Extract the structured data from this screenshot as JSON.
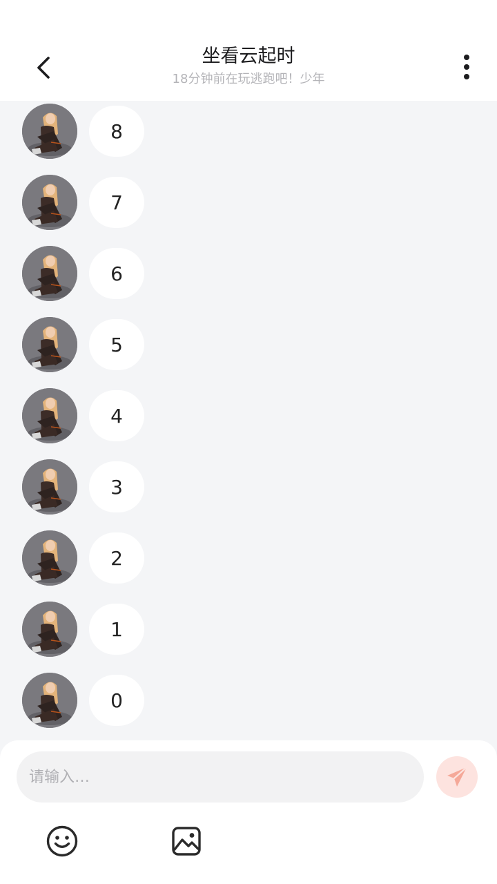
{
  "header": {
    "title": "坐看云起时",
    "subtitle": "18分钟前在玩逃跑吧！少年"
  },
  "messages": [
    {
      "text": "8"
    },
    {
      "text": "7"
    },
    {
      "text": "6"
    },
    {
      "text": "5"
    },
    {
      "text": "4"
    },
    {
      "text": "3"
    },
    {
      "text": "2"
    },
    {
      "text": "1"
    },
    {
      "text": "0"
    }
  ],
  "composer": {
    "placeholder": "请输入…",
    "value": ""
  },
  "colors": {
    "page_bg": "#f4f5f7",
    "bubble_bg": "#ffffff",
    "send_button_bg": "#fde3df",
    "send_icon": "#f5a898",
    "subtitle_text": "#b4b4b8"
  },
  "icons": {
    "back": "chevron-left-icon",
    "more": "more-vertical-icon",
    "send": "paper-plane-icon",
    "emoji": "smiley-face-icon",
    "image": "image-icon"
  }
}
